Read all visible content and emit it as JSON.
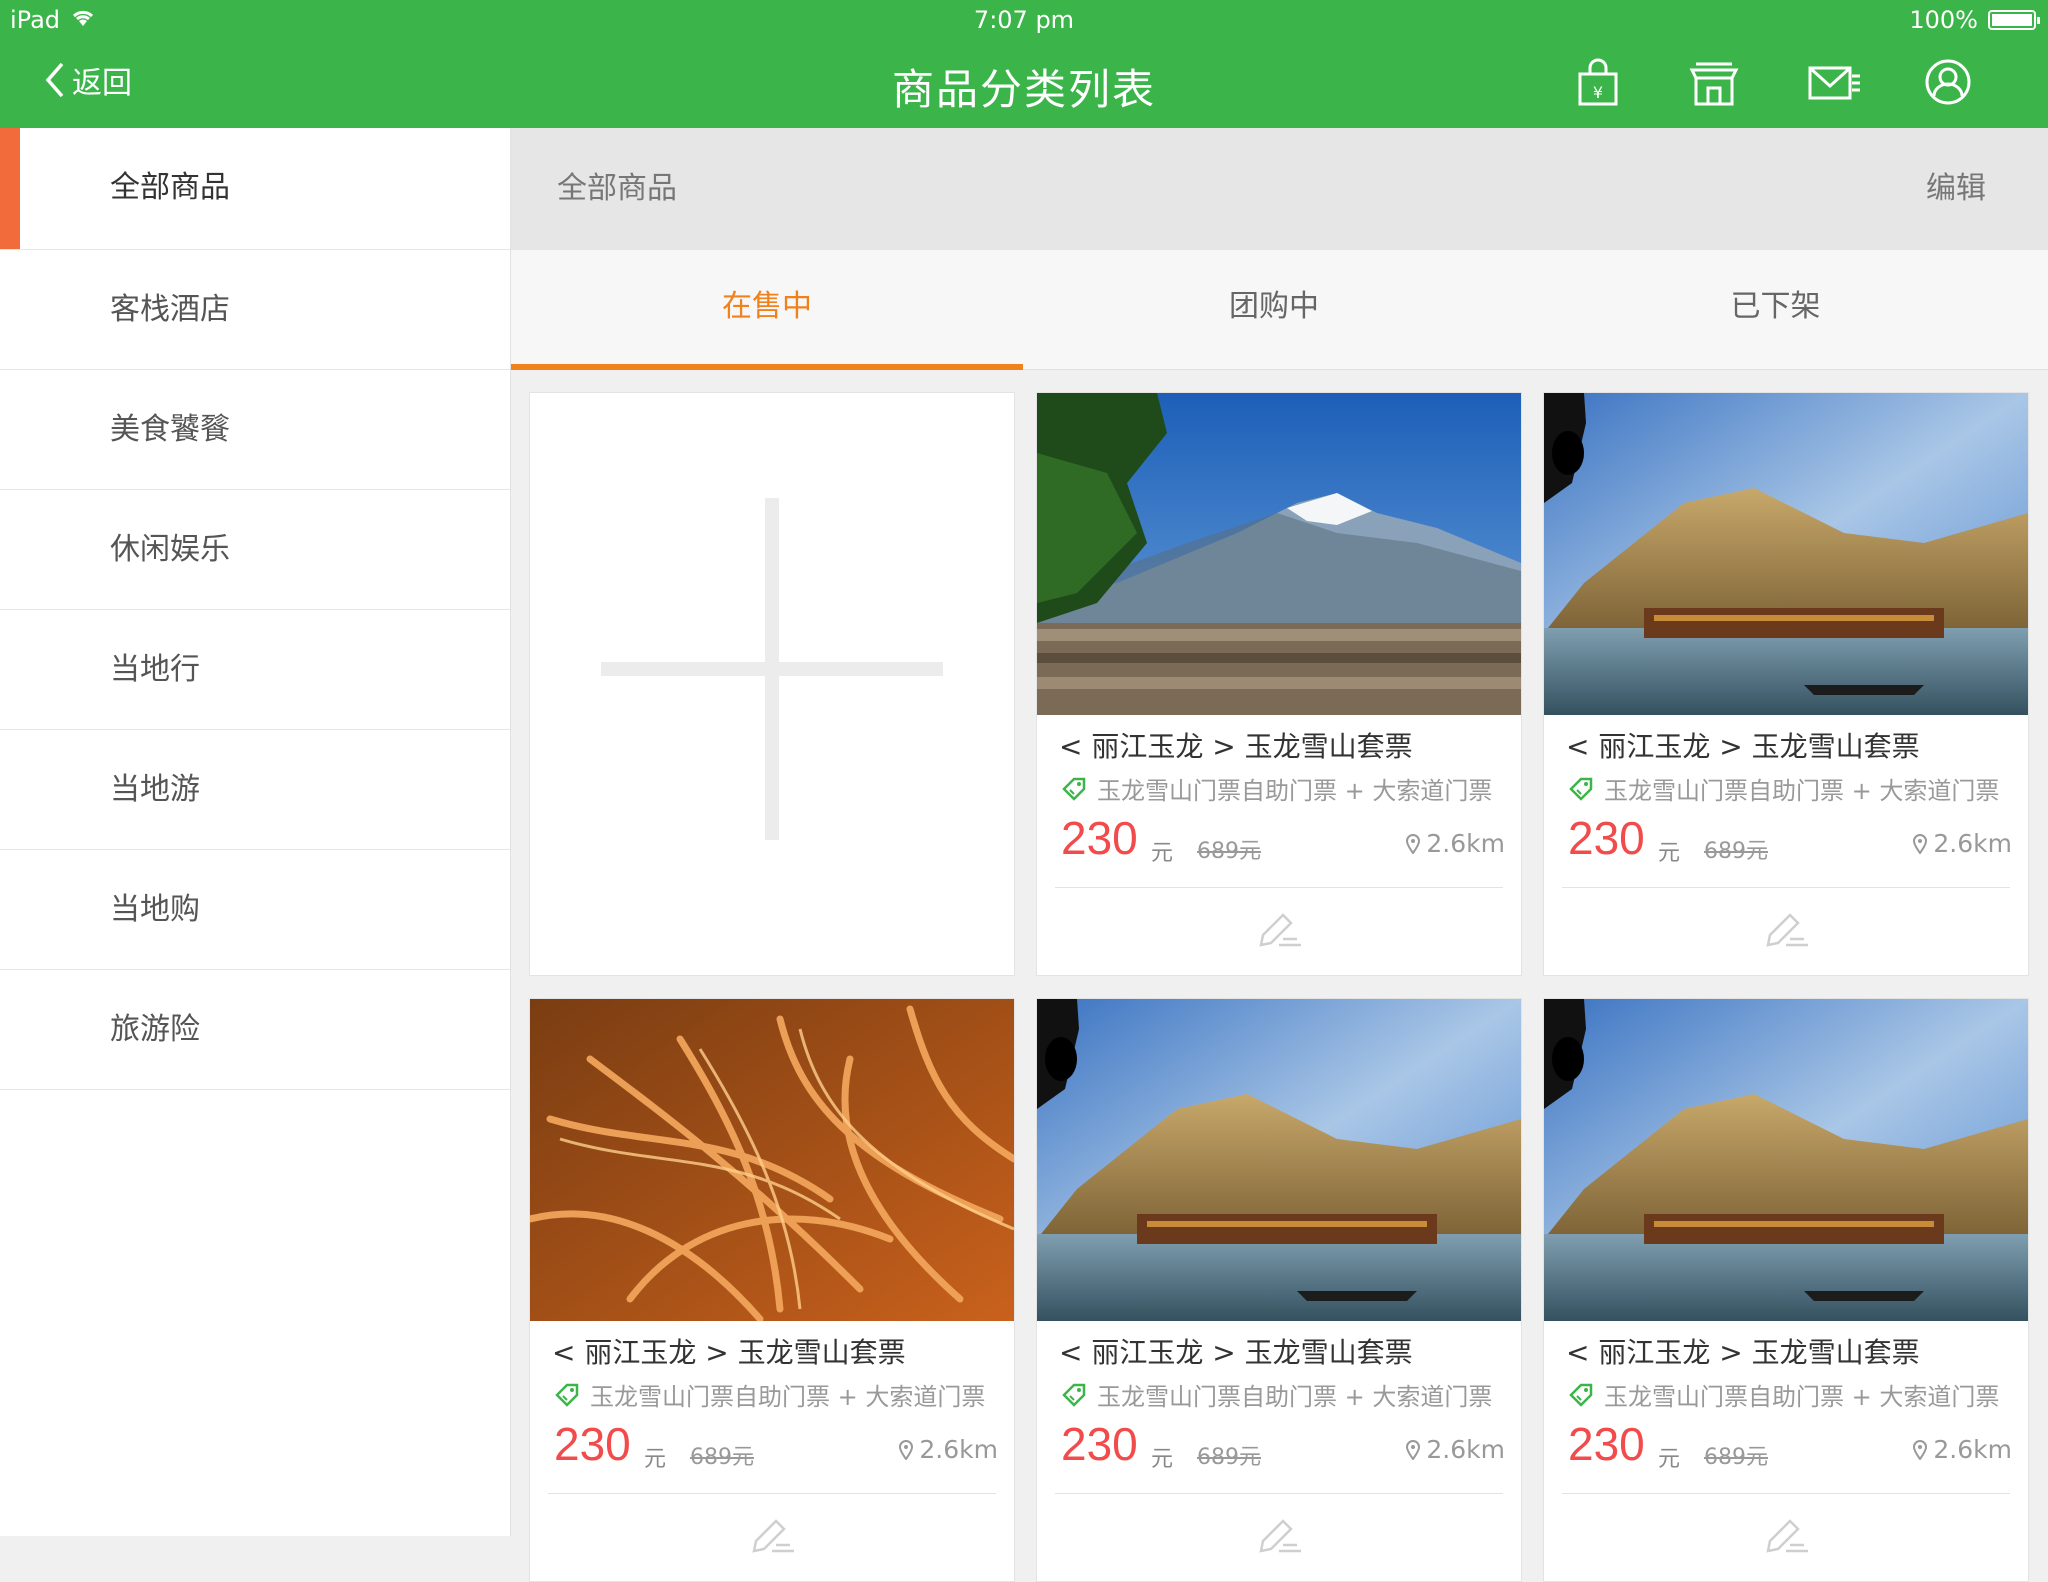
{
  "status_bar": {
    "device": "iPad",
    "time": "7:07 pm",
    "battery": "100%"
  },
  "nav": {
    "back_label": "返回",
    "title": "商品分类列表",
    "icons": [
      "shopping-bag-icon",
      "store-icon",
      "mail-icon",
      "user-icon"
    ]
  },
  "sidebar": {
    "items": [
      {
        "label": "全部商品",
        "active": true
      },
      {
        "label": "客栈酒店"
      },
      {
        "label": "美食饕餮"
      },
      {
        "label": "休闲娱乐"
      },
      {
        "label": "当地行"
      },
      {
        "label": "当地游"
      },
      {
        "label": "当地购"
      },
      {
        "label": "旅游险"
      }
    ]
  },
  "section": {
    "title": "全部商品",
    "edit_label": "编辑"
  },
  "tabs": [
    {
      "label": "在售中",
      "active": true
    },
    {
      "label": "团购中"
    },
    {
      "label": "已下架"
    }
  ],
  "products": [
    {
      "image": "snow-mountain-village",
      "title": "< 丽江玉龙 > 玉龙雪山套票",
      "subtitle": "玉龙雪山门票自助门票 + 大索道门票",
      "price": "230",
      "unit": "元",
      "original_price": "689元",
      "distance": "2.6km"
    },
    {
      "image": "riverside-town",
      "title": "< 丽江玉龙 > 玉龙雪山套票",
      "subtitle": "玉龙雪山门票自助门票 + 大索道门票",
      "price": "230",
      "unit": "元",
      "original_price": "689元",
      "distance": "2.6km"
    },
    {
      "image": "dried-cordyceps",
      "title": "< 丽江玉龙 > 玉龙雪山套票",
      "subtitle": "玉龙雪山门票自助门票 + 大索道门票",
      "price": "230",
      "unit": "元",
      "original_price": "689元",
      "distance": "2.6km"
    },
    {
      "image": "riverside-town",
      "title": "< 丽江玉龙 > 玉龙雪山套票",
      "subtitle": "玉龙雪山门票自助门票 + 大索道门票",
      "price": "230",
      "unit": "元",
      "original_price": "689元",
      "distance": "2.6km"
    },
    {
      "image": "riverside-town",
      "title": "< 丽江玉龙 > 玉龙雪山套票",
      "subtitle": "玉龙雪山门票自助门票 + 大索道门票",
      "price": "230",
      "unit": "元",
      "original_price": "689元",
      "distance": "2.6km"
    }
  ],
  "colors": {
    "nav_green": "#3bb54a",
    "accent_orange": "#f0821e",
    "sidebar_marker": "#f26b3a",
    "price_red": "#f14b4b"
  }
}
